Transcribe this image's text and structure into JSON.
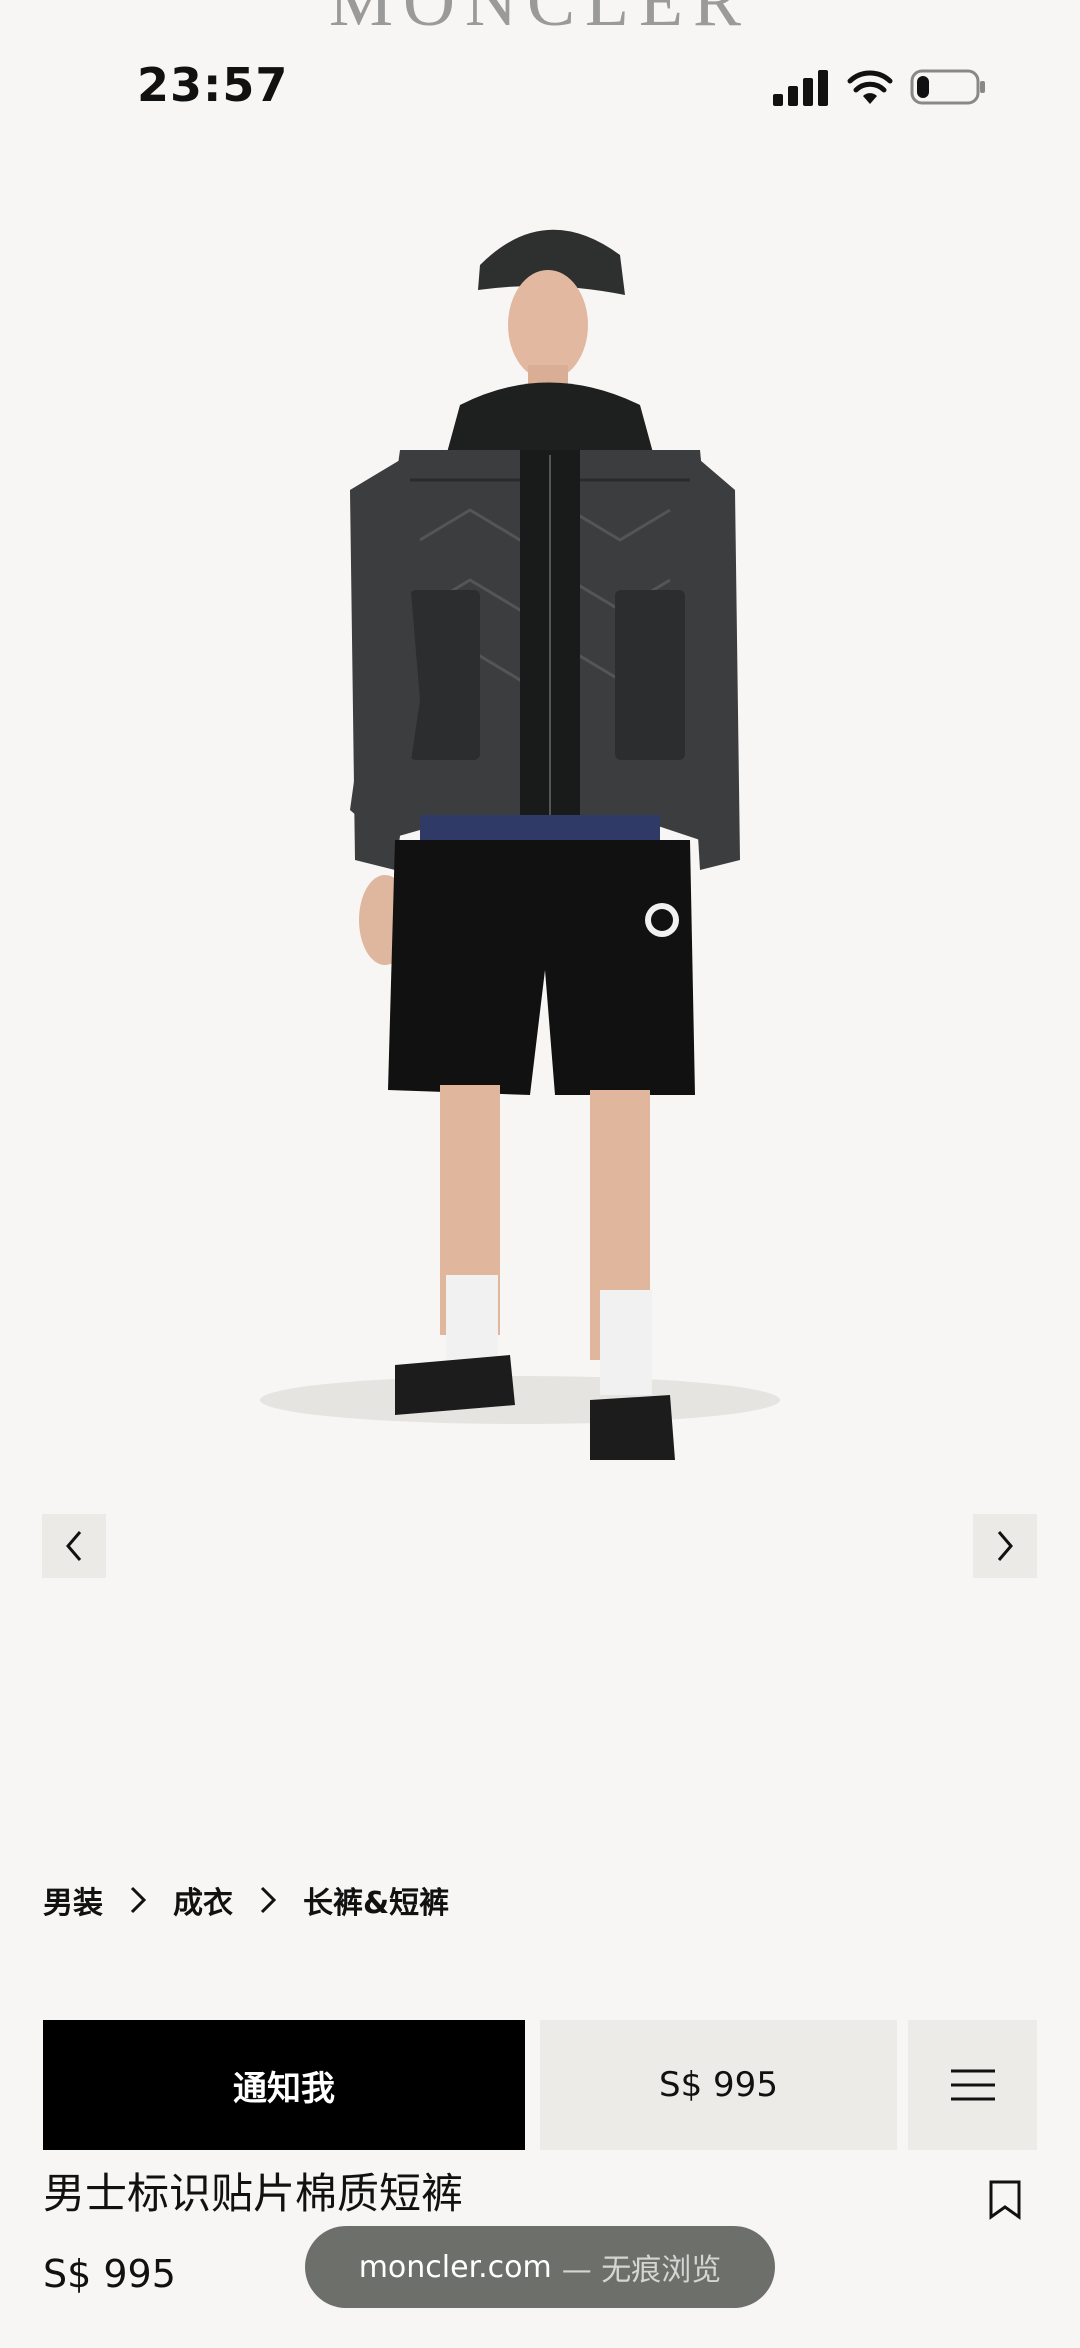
{
  "brand": "MONCLER",
  "status_bar": {
    "time": "23:57",
    "battery_level": 0.2
  },
  "icons": {
    "signal": "cellular-signal-icon",
    "wifi": "wifi-icon",
    "battery": "battery-icon",
    "prev": "chevron-left-icon",
    "next": "chevron-right-icon",
    "menu": "hamburger-menu-icon",
    "bookmark": "bookmark-icon"
  },
  "breadcrumb": [
    "男装",
    "成衣",
    "长裤&短裤"
  ],
  "actions": {
    "notify_label": "通知我",
    "price_label": "S$ 995"
  },
  "product": {
    "title": "男士标识贴片棉质短裤",
    "price": "S$ 995"
  },
  "browser": {
    "domain": "moncler.com",
    "mode_label": "— 无痕浏览"
  },
  "colors": {
    "background": "#f7f6f4",
    "primary_button": "#000000",
    "secondary_button": "#ecebe8"
  }
}
